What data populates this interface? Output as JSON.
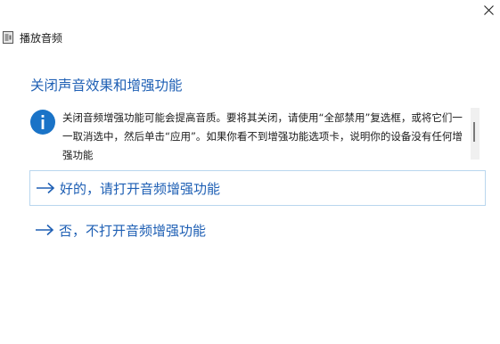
{
  "window": {
    "title": "播放音频",
    "close_icon": "close-icon",
    "app_icon": "audio-troubleshooter-icon"
  },
  "heading": "关闭声音效果和增强功能",
  "info": {
    "icon": "info-icon",
    "text": "关闭音频增强功能可能会提高音质。要将其关闭，请使用“全部禁用”复选框，或将它们一一取消选中，然后单击“应用”。如果你看不到增强功能选项卡，说明你的设备没有任何增强功能"
  },
  "options": [
    {
      "label": "好的，请打开音频增强功能",
      "icon": "arrow-right-icon",
      "selected": true
    },
    {
      "label": "否，不打开音频增强功能",
      "icon": "arrow-right-icon",
      "selected": false
    }
  ],
  "colors": {
    "accent": "#1e5fb4",
    "info_circle": "#1a73c7",
    "selected_border": "#b9d6ee"
  }
}
